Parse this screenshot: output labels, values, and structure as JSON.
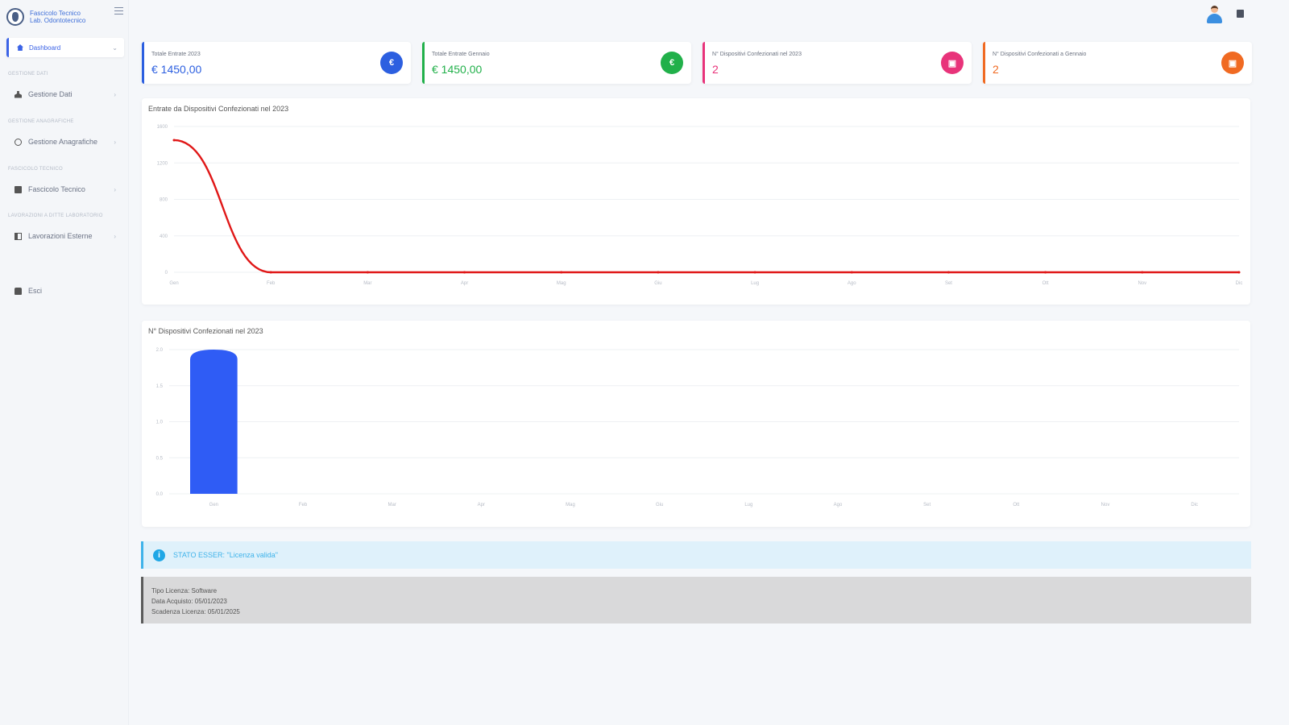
{
  "brand": {
    "line1": "Fascicolo Tecnico",
    "line2": "Lab. Odontotecnico"
  },
  "sidebar": {
    "active": {
      "label": "Dashboard"
    },
    "sections": [
      {
        "header": "Gestione Dati",
        "item": "Gestione Dati"
      },
      {
        "header": "Gestione Anagrafiche",
        "item": "Gestione Anagrafiche"
      },
      {
        "header": "Fascicolo Tecnico",
        "item": "Fascicolo Tecnico"
      },
      {
        "header": "Lavorazioni a Ditte Laboratorio",
        "item": "Lavorazioni Esterne"
      }
    ],
    "logout": "Esci"
  },
  "cards": [
    {
      "title": "Totale Entrate 2023",
      "value": "€ 1450,00",
      "icon": "€",
      "color": "#2c5fe0"
    },
    {
      "title": "Totale Entrate Gennaio",
      "value": "€ 1450,00",
      "icon": "€",
      "color": "#21b04a"
    },
    {
      "title": "N° Dispositivi Confezionati nel 2023",
      "value": "2",
      "icon": "▣",
      "color": "#e8337a"
    },
    {
      "title": "N° Dispositivi Confezionati a Gennaio",
      "value": "2",
      "icon": "▣",
      "color": "#f06a22"
    }
  ],
  "chart_data": [
    {
      "type": "line",
      "title": "Entrate da Dispositivi Confezionati nel 2023",
      "categories": [
        "Gen",
        "Feb",
        "Mar",
        "Apr",
        "Mag",
        "Giu",
        "Lug",
        "Ago",
        "Set",
        "Ott",
        "Nov",
        "Dic"
      ],
      "values": [
        1450,
        0,
        0,
        0,
        0,
        0,
        0,
        0,
        0,
        0,
        0,
        0
      ],
      "y_ticks": [
        "0",
        "400",
        "800",
        "1200",
        "1600"
      ],
      "ylim": [
        0,
        1600
      ],
      "color": "#e01717",
      "grid": true
    },
    {
      "type": "bar",
      "title": "N° Dispositivi Confezionati nel 2023",
      "categories": [
        "Gen",
        "Feb",
        "Mar",
        "Apr",
        "Mag",
        "Giu",
        "Lug",
        "Ago",
        "Set",
        "Ott",
        "Nov",
        "Dic"
      ],
      "values": [
        2,
        0,
        0,
        0,
        0,
        0,
        0,
        0,
        0,
        0,
        0,
        0
      ],
      "y_ticks": [
        "0.0",
        "0.5",
        "1.0",
        "1.5",
        "2.0"
      ],
      "ylim": [
        0,
        2
      ],
      "color": "#2f5cf5",
      "grid": true
    }
  ],
  "alert": {
    "text": "STATO ESSER: \"Licenza valida\""
  },
  "license": {
    "line1": "Tipo Licenza: Software",
    "line2": "Data Acquisto: 05/01/2023",
    "line3": "Scadenza Licenza: 05/01/2025"
  }
}
